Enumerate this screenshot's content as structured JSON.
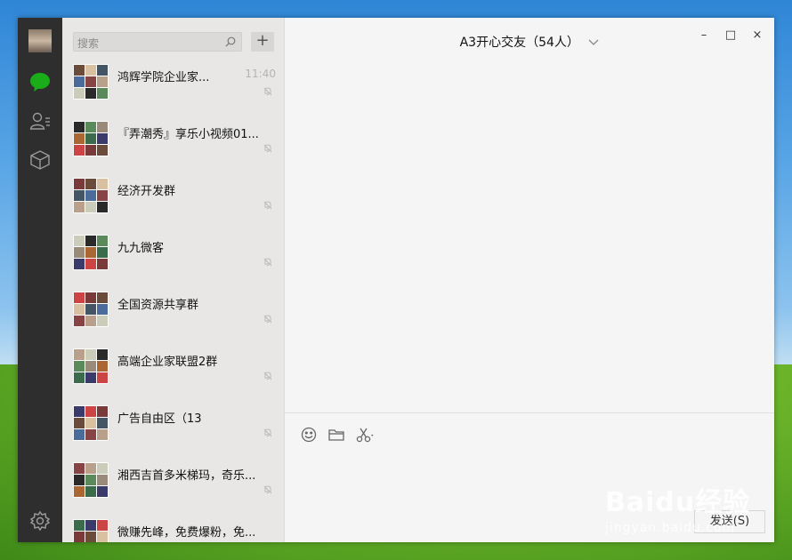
{
  "window": {
    "title": "A3开心交友（54人）",
    "controls": {
      "minimize": "–",
      "maximize": "□",
      "close": "×"
    }
  },
  "search": {
    "placeholder": "搜索"
  },
  "add_label": "+",
  "chats": [
    {
      "name": "鸿辉学院企业家...",
      "time": "11:40"
    },
    {
      "name": "『弄潮秀』享乐小视频01...",
      "time": ""
    },
    {
      "name": "经济开发群",
      "time": ""
    },
    {
      "name": "九九微客",
      "time": ""
    },
    {
      "name": "全国资源共享群",
      "time": ""
    },
    {
      "name": "高端企业家联盟2群",
      "time": ""
    },
    {
      "name": "广告自由区（13",
      "time": ""
    },
    {
      "name": "湘西吉首多米梯玛，奇乐...",
      "time": ""
    },
    {
      "name": "微赚先峰，免费爆粉，免...",
      "time": ""
    }
  ],
  "composer": {
    "send_label": "发送(S)"
  },
  "watermark": {
    "brand": "Baidu经验",
    "url": "jingyan.baidu.com"
  },
  "colors": {
    "sidebar": "#2e2e2e",
    "chat_active_icon": "#1aad19",
    "list_bg": "#e8e7e6",
    "main_bg": "#f5f5f5"
  },
  "icons": {
    "sidebar": [
      "chat-icon",
      "contacts-icon",
      "favorites-box-icon",
      "settings-gear-icon"
    ],
    "toolbar": [
      "emoji-icon",
      "folder-icon",
      "screenshot-scissors-icon"
    ]
  }
}
